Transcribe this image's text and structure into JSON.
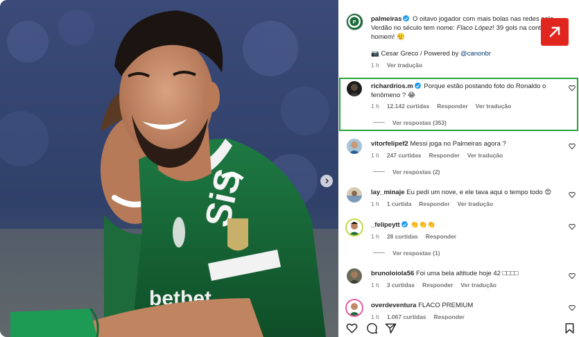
{
  "post": {
    "author": "palmeiras",
    "caption_pre": "O oitavo jogador com mais bolas nas redes pelo Verdão no século tem nome: ",
    "caption_em": "Flaco López",
    "caption_post": "! 39 gols na conta do homem! 😮‍💨",
    "credit": "📷 Cesar Greco / Powered by ",
    "credit_handle": "@canonbr",
    "time": "1 h",
    "translate": "Ver tradução"
  },
  "comments": [
    {
      "user": "richardrios.m",
      "verified": true,
      "text": "Porque estão postando foto do Ronaldo o fenômeno ? 😂",
      "time": "1 h",
      "likes": "12.142 curtidas",
      "reply": "Responder",
      "translate": "Ver tradução",
      "replies": "Ver respostas (353)"
    },
    {
      "user": "vitorfelipef2",
      "verified": false,
      "text": "Messi joga no Palmeiras agora ?",
      "time": "1 h",
      "likes": "247 curtidas",
      "reply": "Responder",
      "translate": "Ver tradução",
      "replies": "Ver respostas (2)"
    },
    {
      "user": "lay_minaje",
      "verified": false,
      "text": "Eu pedi um nove, e ele tava aqui o tempo todo 😍",
      "time": "1 h",
      "likes": "1 curtida",
      "reply": "Responder",
      "translate": "Ver tradução",
      "replies": ""
    },
    {
      "user": "_felipeytt",
      "verified": true,
      "text": "👏👏👏",
      "time": "1 h",
      "likes": "28 curtidas",
      "reply": "Responder",
      "translate": "",
      "replies": "Ver respostas (1)"
    },
    {
      "user": "brunoloiola56",
      "verified": false,
      "text": "Foi uma bela altitude hoje 42 ",
      "text_suffix": "□□□□",
      "time": "1 h",
      "likes": "3 curtidas",
      "reply": "Responder",
      "translate": "Ver tradução",
      "replies": ""
    },
    {
      "user": "overdeventura",
      "verified": false,
      "text": "FLACO PREMIUM",
      "time": "1 h",
      "likes": "1.067 curtidas",
      "reply": "Responder",
      "translate": "",
      "replies": ""
    }
  ],
  "icons": {
    "external": "external-link-icon",
    "like": "heart-icon",
    "comment": "comment-icon",
    "share": "paper-plane-icon",
    "save": "bookmark-icon",
    "next": "chevron-right-icon"
  },
  "colors": {
    "highlight": "#23a33a",
    "external_button": "#e0261f",
    "verified": "#1d9bf0",
    "kit_green": "#1b6b39"
  }
}
